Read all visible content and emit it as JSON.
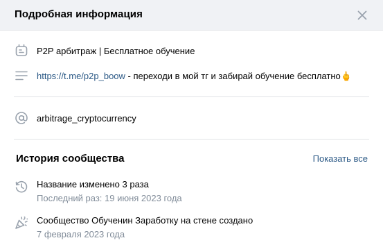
{
  "header": {
    "title": "Подробная информация",
    "close_icon": "close-icon"
  },
  "info": {
    "description": {
      "icon": "info-card-icon",
      "text": "P2P арбитраж | Бесплатное обучение"
    },
    "link": {
      "icon": "menu-lines-icon",
      "url": "https://t.me/p2p_boow",
      "text": " - переходи в мой тг и забирай обучение бесплатно",
      "emoji": "🖕"
    },
    "handle": {
      "icon": "at-sign-icon",
      "text": "arbitrage_cryptocurrency"
    }
  },
  "history": {
    "title": "История сообщества",
    "show_all": "Показать все",
    "items": [
      {
        "icon": "history-clock-icon",
        "line1": "Название изменено 3 раза",
        "line2": "Последний раз: 19 июня 2023 года"
      },
      {
        "icon": "party-popper-icon",
        "line1": "Сообщество Обученин Заработку на стене создано",
        "line2": "7 февраля 2023 года"
      }
    ]
  },
  "colors": {
    "header_bg": "#f0f2f5",
    "link": "#2a5885",
    "icon": "#99a2ad",
    "secondary_text": "#818c99",
    "divider": "#e1e3e6"
  }
}
